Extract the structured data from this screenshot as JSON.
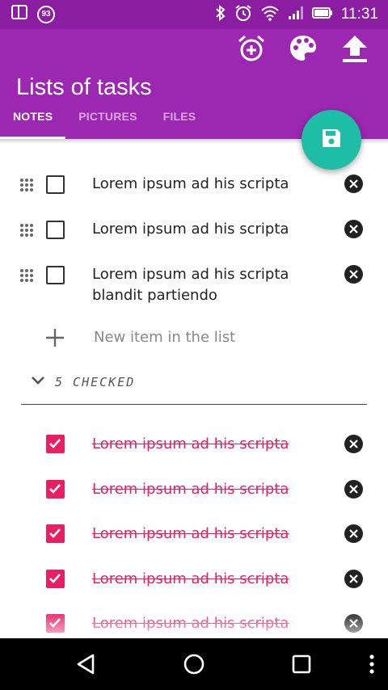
{
  "status_bar": {
    "time": "11:31",
    "notification_badge": "93",
    "icons": [
      "screen-icon",
      "notification-badge",
      "bluetooth-icon",
      "alarm-icon",
      "wifi-icon",
      "signal-icon",
      "battery-icon"
    ]
  },
  "app_bar": {
    "title": "Lists of tasks",
    "actions": [
      "add-alarm-icon",
      "palette-icon",
      "upload-icon"
    ],
    "color": "#9c27b0"
  },
  "tabs": [
    {
      "label": "NOTES",
      "active": true
    },
    {
      "label": "PICTURES",
      "active": false
    },
    {
      "label": "FILES",
      "active": false
    }
  ],
  "fab": {
    "icon": "save-icon",
    "color": "#1ebda6"
  },
  "unchecked_items": [
    {
      "text": "Lorem ipsum ad his scripta"
    },
    {
      "text": "Lorem ipsum ad his scripta"
    },
    {
      "text": "Lorem ipsum ad his scripta blandit partiendo"
    }
  ],
  "new_item": {
    "placeholder": "New item in the list"
  },
  "checked_section": {
    "label": "5 CHECKED",
    "accent": "#e91e63"
  },
  "checked_items": [
    {
      "text": "Lorem ipsum ad his scripta"
    },
    {
      "text": "Lorem ipsum ad his scripta"
    },
    {
      "text": "Lorem ipsum ad his scripta"
    },
    {
      "text": "Lorem ipsum ad his scripta"
    },
    {
      "text": "Lorem ipsum ad his scripta"
    }
  ],
  "nav_bar": {
    "buttons": [
      "back-icon",
      "home-icon",
      "recents-icon",
      "menu-icon"
    ]
  }
}
